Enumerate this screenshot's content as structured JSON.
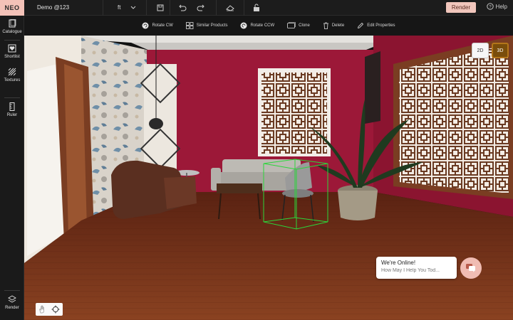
{
  "topbar": {
    "logo": "NEO",
    "project_name": "Demo @123",
    "unit": "ft",
    "render_label": "Render",
    "help_label": "Help"
  },
  "context_toolbar": {
    "items": [
      {
        "label": "Rotate CW",
        "icon": "rotate-cw-icon"
      },
      {
        "label": "Similar Products",
        "icon": "similar-products-icon"
      },
      {
        "label": "Rotate CCW",
        "icon": "rotate-ccw-icon"
      },
      {
        "label": "Clone",
        "icon": "clone-icon"
      },
      {
        "label": "Delete",
        "icon": "trash-icon"
      },
      {
        "label": "Edit Properties",
        "icon": "pencil-icon"
      }
    ]
  },
  "sidebar": {
    "items": [
      {
        "label": "Catalogue",
        "icon": "catalogue-icon"
      },
      {
        "label": "Shortlist",
        "icon": "heart-icon"
      },
      {
        "label": "Textures",
        "icon": "textures-icon"
      },
      {
        "label": "Ruler",
        "icon": "ruler-icon"
      },
      {
        "label": "Render",
        "icon": "render-icon"
      }
    ]
  },
  "view_toggle": {
    "option_2d": "2D",
    "option_3d": "3D",
    "active": "3D"
  },
  "chat": {
    "title": "We're Online!",
    "subtitle": "How May I Help You Tod..."
  },
  "colors": {
    "accent": "#f1c6bc",
    "wall": "#9c1838",
    "floor": "#6e2f19",
    "toolbar_bg": "#1c1c1c",
    "selection": "#2bd63a"
  }
}
